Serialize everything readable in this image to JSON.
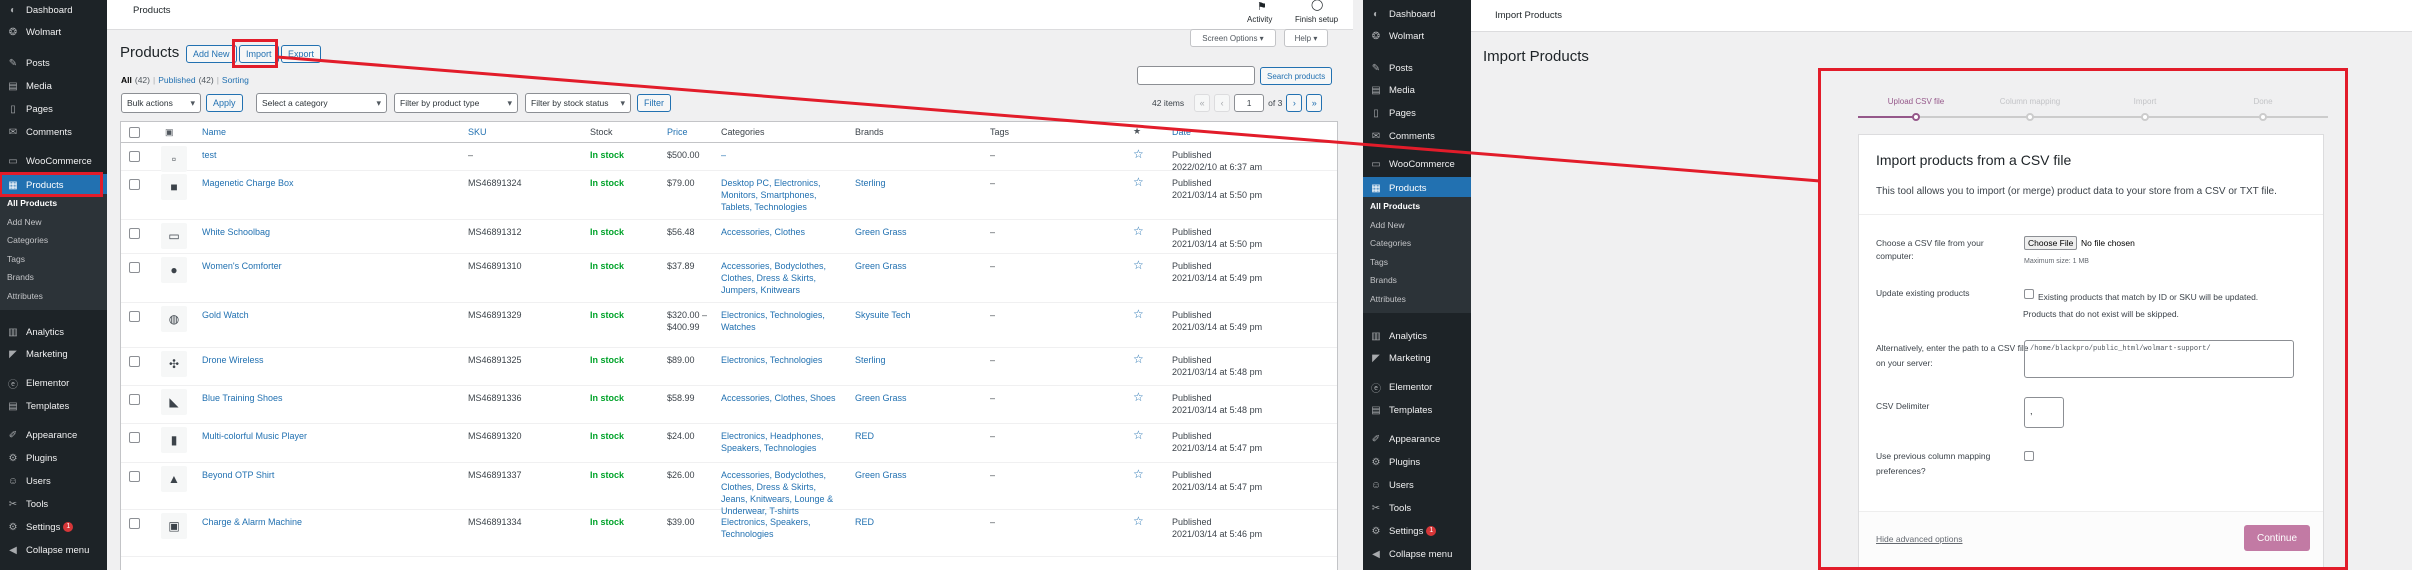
{
  "left": {
    "sidebar": {
      "items": [
        {
          "label": "Dashboard",
          "icon": "dashboard-icon"
        },
        {
          "label": "Wolmart",
          "icon": "wolmart-icon"
        },
        {
          "label": "Posts",
          "icon": "pin-icon"
        },
        {
          "label": "Media",
          "icon": "media-icon"
        },
        {
          "label": "Pages",
          "icon": "page-icon"
        },
        {
          "label": "Comments",
          "icon": "comment-icon"
        },
        {
          "label": "WooCommerce",
          "icon": "woo-icon"
        },
        {
          "label": "Products",
          "icon": "products-icon"
        },
        {
          "label": "Analytics",
          "icon": "analytics-icon"
        },
        {
          "label": "Marketing",
          "icon": "megaphone-icon"
        },
        {
          "label": "Elementor",
          "icon": "elementor-icon"
        },
        {
          "label": "Templates",
          "icon": "templates-icon"
        },
        {
          "label": "Appearance",
          "icon": "brush-icon"
        },
        {
          "label": "Plugins",
          "icon": "plugin-icon"
        },
        {
          "label": "Users",
          "icon": "users-icon"
        },
        {
          "label": "Tools",
          "icon": "wrench-icon"
        },
        {
          "label": "Settings",
          "icon": "settings-icon",
          "badge": "1"
        },
        {
          "label": "Collapse menu",
          "icon": "collapse-icon"
        }
      ],
      "subitems": [
        "All Products",
        "Add New",
        "Categories",
        "Tags",
        "Brands",
        "Attributes"
      ]
    },
    "topbar": {
      "title": "Products",
      "activity": "Activity",
      "finish": "Finish setup"
    },
    "screen_options": "Screen Options ▾",
    "help": "Help ▾",
    "heading": "Products",
    "buttons": {
      "add_new": "Add New",
      "import": "Import",
      "export": "Export"
    },
    "views": {
      "all": "All",
      "all_count": "(42)",
      "sep1": "|",
      "published": "Published",
      "published_count": "(42)",
      "sep2": "|",
      "sorting": "Sorting"
    },
    "search_button": "Search products",
    "filters": {
      "bulk": "Bulk actions",
      "apply": "Apply",
      "category": "Select a category",
      "type": "Filter by product type",
      "stock": "Filter by stock status",
      "filter": "Filter"
    },
    "pagination": {
      "items": "42 items",
      "first": "«",
      "prev": "‹",
      "page": "1",
      "of": "of 3",
      "next": "›",
      "last": "»"
    },
    "columns": [
      "Name",
      "SKU",
      "Stock",
      "Price",
      "Categories",
      "Brands",
      "Tags",
      "Date"
    ],
    "rows": [
      {
        "name": "test",
        "sku": "–",
        "stock": "In stock",
        "price": "$500.00",
        "categories": "–",
        "brands": "",
        "tags": "–",
        "status": "Published",
        "date": "2022/02/10 at 6:37 am",
        "thumb": "▫"
      },
      {
        "name": "Magenetic Charge Box",
        "sku": "MS46891324",
        "stock": "In stock",
        "price": "$79.00",
        "categories": "Desktop PC, Electronics, Monitors, Smartphones, Tablets, Technologies",
        "brands": "Sterling",
        "tags": "–",
        "status": "Published",
        "date": "2021/03/14 at 5:50 pm",
        "thumb": "■"
      },
      {
        "name": "White Schoolbag",
        "sku": "MS46891312",
        "stock": "In stock",
        "price": "$56.48",
        "categories": "Accessories, Clothes",
        "brands": "Green Grass",
        "tags": "–",
        "status": "Published",
        "date": "2021/03/14 at 5:50 pm",
        "thumb": "▭"
      },
      {
        "name": "Women's Comforter",
        "sku": "MS46891310",
        "stock": "In stock",
        "price": "$37.89",
        "categories": "Accessories, Bodyclothes, Clothes, Dress & Skirts, Jumpers, Knitwears",
        "brands": "Green Grass",
        "tags": "–",
        "status": "Published",
        "date": "2021/03/14 at 5:49 pm",
        "thumb": "●"
      },
      {
        "name": "Gold Watch",
        "sku": "MS46891329",
        "stock": "In stock",
        "price": "$320.00 – $400.99",
        "categories": "Electronics, Technologies, Watches",
        "brands": "Skysuite Tech",
        "tags": "–",
        "status": "Published",
        "date": "2021/03/14 at 5:49 pm",
        "thumb": "◍"
      },
      {
        "name": "Drone Wireless",
        "sku": "MS46891325",
        "stock": "In stock",
        "price": "$89.00",
        "categories": "Electronics, Technologies",
        "brands": "Sterling",
        "tags": "–",
        "status": "Published",
        "date": "2021/03/14 at 5:48 pm",
        "thumb": "✣"
      },
      {
        "name": "Blue Training Shoes",
        "sku": "MS46891336",
        "stock": "In stock",
        "price": "$58.99",
        "categories": "Accessories, Clothes, Shoes",
        "brands": "Green Grass",
        "tags": "–",
        "status": "Published",
        "date": "2021/03/14 at 5:48 pm",
        "thumb": "◣"
      },
      {
        "name": "Multi-colorful Music Player",
        "sku": "MS46891320",
        "stock": "In stock",
        "price": "$24.00",
        "categories": "Electronics, Headphones, Speakers, Technologies",
        "brands": "RED",
        "tags": "–",
        "status": "Published",
        "date": "2021/03/14 at 5:47 pm",
        "thumb": "▮"
      },
      {
        "name": "Beyond OTP Shirt",
        "sku": "MS46891337",
        "stock": "In stock",
        "price": "$26.00",
        "categories": "Accessories, Bodyclothes, Clothes, Dress & Skirts, Jeans, Knitwears, Lounge & Underwear, T-shirts",
        "brands": "Green Grass",
        "tags": "–",
        "status": "Published",
        "date": "2021/03/14 at 5:47 pm",
        "thumb": "▲"
      },
      {
        "name": "Charge & Alarm Machine",
        "sku": "MS46891334",
        "stock": "In stock",
        "price": "$39.00",
        "categories": "Electronics, Speakers, Technologies",
        "brands": "RED",
        "tags": "–",
        "status": "Published",
        "date": "2021/03/14 at 5:46 pm",
        "thumb": "▣"
      }
    ]
  },
  "right": {
    "sidebar": {
      "items": [
        {
          "label": "Dashboard",
          "icon": "dashboard-icon"
        },
        {
          "label": "Wolmart",
          "icon": "wolmart-icon"
        },
        {
          "label": "Posts",
          "icon": "pin-icon"
        },
        {
          "label": "Media",
          "icon": "media-icon"
        },
        {
          "label": "Pages",
          "icon": "page-icon"
        },
        {
          "label": "Comments",
          "icon": "comment-icon"
        },
        {
          "label": "WooCommerce",
          "icon": "woo-icon"
        },
        {
          "label": "Products",
          "icon": "products-icon"
        },
        {
          "label": "Analytics",
          "icon": "analytics-icon"
        },
        {
          "label": "Marketing",
          "icon": "megaphone-icon"
        },
        {
          "label": "Elementor",
          "icon": "elementor-icon"
        },
        {
          "label": "Templates",
          "icon": "templates-icon"
        },
        {
          "label": "Appearance",
          "icon": "brush-icon"
        },
        {
          "label": "Plugins",
          "icon": "plugin-icon"
        },
        {
          "label": "Users",
          "icon": "users-icon"
        },
        {
          "label": "Tools",
          "icon": "wrench-icon"
        },
        {
          "label": "Settings",
          "icon": "settings-icon",
          "badge": "1"
        },
        {
          "label": "Collapse menu",
          "icon": "collapse-icon"
        }
      ],
      "subitems": [
        "All Products",
        "Add New",
        "Categories",
        "Tags",
        "Brands",
        "Attributes"
      ]
    },
    "topbar_title": "Import Products",
    "heading": "Import Products",
    "steps": [
      "Upload CSV file",
      "Column mapping",
      "Import",
      "Done"
    ],
    "card_title": "Import products from a CSV file",
    "card_desc": "This tool allows you to import (or merge) product data to your store from a CSV or TXT file.",
    "choose_label": "Choose a CSV file from your computer:",
    "choose_button": "Choose File",
    "no_file": "No file chosen",
    "max_size": "Maximum size: 1 MB",
    "update_label": "Update existing products",
    "update_desc": "Existing products that match by ID or SKU will be updated. Products that do not exist will be skipped.",
    "path_label": "Alternatively, enter the path to a CSV file on your server:",
    "path_value": "/home/blackpro/public_html/wolmart-support/",
    "delimiter_label": "CSV Delimiter",
    "delimiter_value": ",",
    "mapping_label": "Use previous column mapping preferences?",
    "hide_advanced": "Hide advanced options",
    "continue": "Continue"
  },
  "colors": {
    "annotation": "#e21c2a",
    "accent": "#2271b1",
    "stock": "#00a32a",
    "continue": "#c27aa4",
    "sidebar": "#1d2327"
  }
}
